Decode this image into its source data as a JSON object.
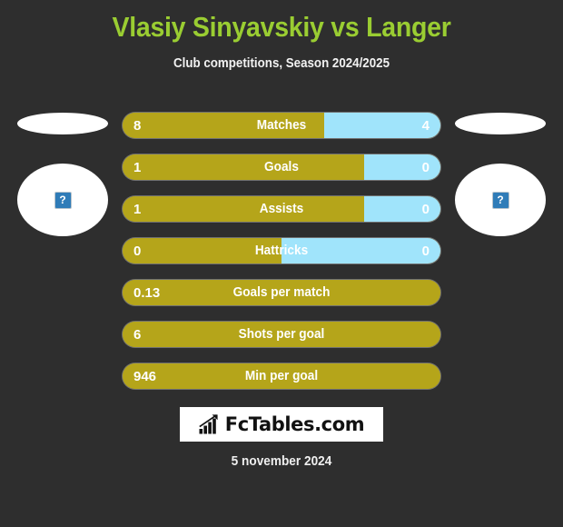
{
  "header": {
    "title": "Vlasiy Sinyavskiy vs Langer",
    "subtitle": "Club competitions, Season 2024/2025"
  },
  "colors": {
    "background": "#2e2e2e",
    "title_green": "#9acd32",
    "home_bar": "#b5a51a",
    "away_bar": "#a0e4fb",
    "text_white": "#ffffff"
  },
  "players": {
    "home": {
      "flag_placeholder": "broken-image",
      "photo_placeholder": "broken-image",
      "placeholder_glyph": "?"
    },
    "away": {
      "flag_placeholder": "broken-image",
      "photo_placeholder": "broken-image",
      "placeholder_glyph": "?"
    }
  },
  "stats": [
    {
      "label": "Matches",
      "home": "8",
      "away": "4",
      "home_pct": 63.5,
      "dual": true
    },
    {
      "label": "Goals",
      "home": "1",
      "away": "0",
      "home_pct": 76.0,
      "dual": true
    },
    {
      "label": "Assists",
      "home": "1",
      "away": "0",
      "home_pct": 76.0,
      "dual": true
    },
    {
      "label": "Hattricks",
      "home": "0",
      "away": "0",
      "home_pct": 50.0,
      "dual": true
    },
    {
      "label": "Goals per match",
      "home": "0.13",
      "away": "",
      "home_pct": 100,
      "dual": false
    },
    {
      "label": "Shots per goal",
      "home": "6",
      "away": "",
      "home_pct": 100,
      "dual": false
    },
    {
      "label": "Min per goal",
      "home": "946",
      "away": "",
      "home_pct": 100,
      "dual": false
    }
  ],
  "logo": {
    "text": "FcTables.com",
    "icon": "bar-chart-arrow-icon"
  },
  "footer": {
    "date": "5 november 2024"
  }
}
